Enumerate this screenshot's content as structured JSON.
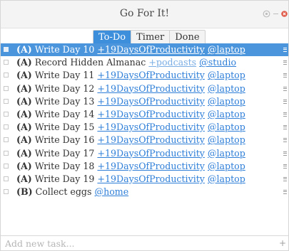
{
  "window": {
    "title": "Go For It!"
  },
  "tabs": [
    {
      "label": "To-Do",
      "active": true
    },
    {
      "label": "Timer",
      "active": false
    },
    {
      "label": "Done",
      "active": false
    }
  ],
  "tasks": [
    {
      "priority": "(A)",
      "text": "Write Day 10",
      "project": "+19DaysOfProductivity",
      "context": "@laptop",
      "selected": true
    },
    {
      "priority": "(A)",
      "text": "Record Hidden Almanac",
      "project": "+podcasts",
      "context": "@studio",
      "selected": false
    },
    {
      "priority": "(A)",
      "text": "Write Day 11",
      "project": "+19DaysOfProductivity",
      "context": "@laptop",
      "selected": false
    },
    {
      "priority": "(A)",
      "text": "Write Day 12",
      "project": "+19DaysOfProductivity",
      "context": "@laptop",
      "selected": false
    },
    {
      "priority": "(A)",
      "text": "Write Day 13",
      "project": "+19DaysOfProductivity",
      "context": "@laptop",
      "selected": false
    },
    {
      "priority": "(A)",
      "text": "Write Day 14",
      "project": "+19DaysOfProductivity",
      "context": "@laptop",
      "selected": false
    },
    {
      "priority": "(A)",
      "text": "Write Day 15",
      "project": "+19DaysOfProductivity",
      "context": "@laptop",
      "selected": false
    },
    {
      "priority": "(A)",
      "text": "Write Day 16",
      "project": "+19DaysOfProductivity",
      "context": "@laptop",
      "selected": false
    },
    {
      "priority": "(A)",
      "text": "Write Day 17",
      "project": "+19DaysOfProductivity",
      "context": "@laptop",
      "selected": false
    },
    {
      "priority": "(A)",
      "text": "Write Day 18",
      "project": "+19DaysOfProductivity",
      "context": "@laptop",
      "selected": false
    },
    {
      "priority": "(A)",
      "text": "Write Day 19",
      "project": "+19DaysOfProductivity",
      "context": "@laptop",
      "selected": false
    },
    {
      "priority": "(B)",
      "text": "Collect eggs",
      "project": "",
      "context": "@home",
      "selected": false
    }
  ],
  "new_task": {
    "placeholder": "Add new task...",
    "value": "",
    "add_icon": "+"
  },
  "colors": {
    "accent": "#3d8fdc",
    "selection": "#4b95dd",
    "link": "#2f7fd8",
    "close": "#e05a4a"
  },
  "icons": {
    "settings": "gear-icon",
    "minimize": "minimize-icon",
    "close": "close-icon",
    "handle": "drag-handle-icon"
  }
}
